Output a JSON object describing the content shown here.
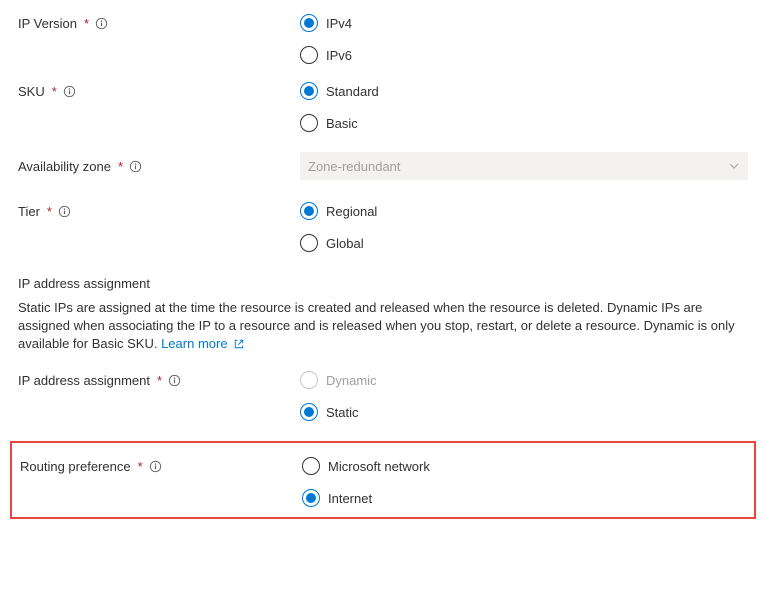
{
  "fields": {
    "ip_version": {
      "label": "IP Version",
      "required_mark": "*",
      "options": {
        "ipv4": "IPv4",
        "ipv6": "IPv6"
      },
      "selected": "ipv4"
    },
    "sku": {
      "label": "SKU",
      "required_mark": "*",
      "options": {
        "standard": "Standard",
        "basic": "Basic"
      },
      "selected": "standard"
    },
    "availability_zone": {
      "label": "Availability zone",
      "required_mark": "*",
      "value": "Zone-redundant"
    },
    "tier": {
      "label": "Tier",
      "required_mark": "*",
      "options": {
        "regional": "Regional",
        "global": "Global"
      },
      "selected": "regional"
    },
    "ip_assignment_section": {
      "title": "IP address assignment",
      "description": "Static IPs are assigned at the time the resource is created and released when the resource is deleted. Dynamic IPs are assigned when associating the IP to a resource and is released when you stop, restart, or delete a resource. Dynamic is only available for Basic SKU. ",
      "learn_more": "Learn more"
    },
    "ip_assignment": {
      "label": "IP address assignment",
      "required_mark": "*",
      "options": {
        "dynamic": "Dynamic",
        "static": "Static"
      },
      "selected": "static",
      "disabled": "dynamic"
    },
    "routing_pref": {
      "label": "Routing preference",
      "required_mark": "*",
      "options": {
        "microsoft": "Microsoft network",
        "internet": "Internet"
      },
      "selected": "internet"
    }
  }
}
